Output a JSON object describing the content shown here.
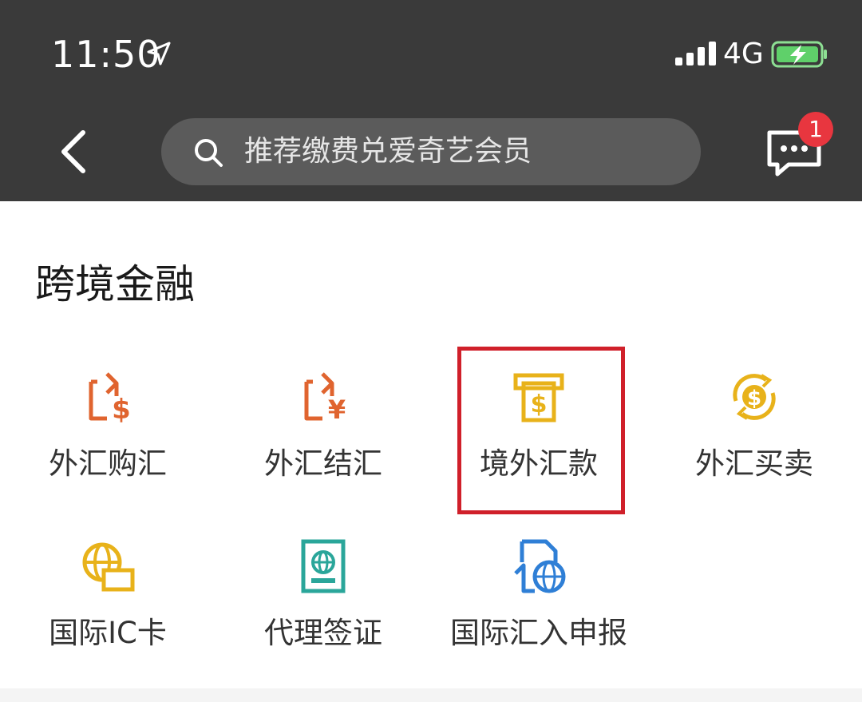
{
  "status_bar": {
    "time": "11:50",
    "network": "4G"
  },
  "header": {
    "search_placeholder": "推荐缴费兑爱奇艺会员",
    "message_badge_count": "1"
  },
  "section": {
    "title": "跨境金融",
    "items": [
      {
        "label": "外汇购汇",
        "icon": "exchange-dollar-icon",
        "color": "#e0642f"
      },
      {
        "label": "外汇结汇",
        "icon": "exchange-yen-icon",
        "color": "#e0642f"
      },
      {
        "label": "境外汇款",
        "icon": "atm-dollar-icon",
        "color": "#e8b21a",
        "highlighted": true
      },
      {
        "label": "外汇买卖",
        "icon": "dollar-cycle-icon",
        "color": "#e8b21a"
      },
      {
        "label": "国际IC卡",
        "icon": "globe-card-icon",
        "color": "#e8b21a"
      },
      {
        "label": "代理签证",
        "icon": "passport-icon",
        "color": "#2aa69a"
      },
      {
        "label": "国际汇入申报",
        "icon": "document-globe-icon",
        "color": "#2f7fd6"
      }
    ]
  },
  "colors": {
    "header_bg": "#3a3a3a",
    "search_bg": "#5b5b5b",
    "badge": "#e8363f",
    "battery": "#5fd06a",
    "highlight": "#d0202a"
  }
}
